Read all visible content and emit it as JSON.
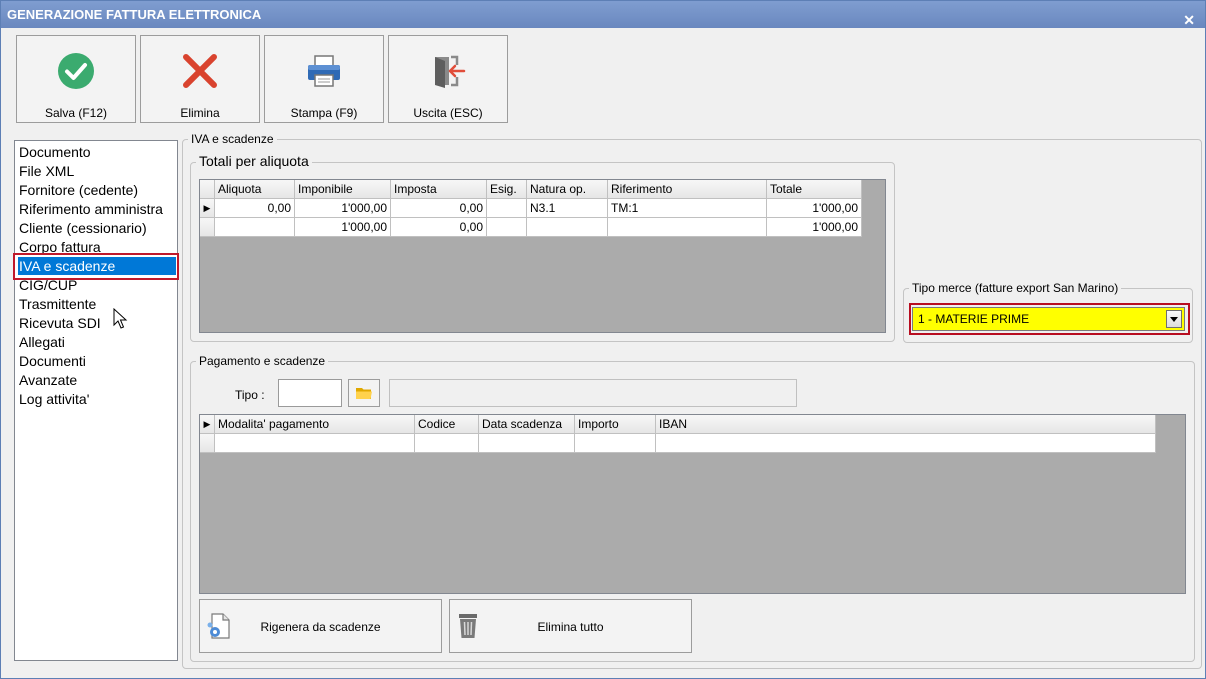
{
  "window": {
    "title": "GENERAZIONE FATTURA ELETTRONICA",
    "close_glyph": "✕"
  },
  "toolbar": [
    {
      "label": "Salva (F12)",
      "icon": "check-circle-icon",
      "color": "#3bab6f"
    },
    {
      "label": "Elimina",
      "icon": "x-mark-icon",
      "color": "#d9432e"
    },
    {
      "label": "Stampa (F9)",
      "icon": "printer-icon",
      "color": "#2f6ab5"
    },
    {
      "label": "Uscita (ESC)",
      "icon": "exit-door-icon",
      "color": "#e14d3a"
    }
  ],
  "nav": {
    "items": [
      "Documento",
      "File XML",
      "Fornitore (cedente)",
      "Riferimento amministra",
      "Cliente (cessionario)",
      "Corpo fattura",
      "IVA e scadenze",
      "CIG/CUP",
      "Trasmittente",
      "Ricevuta SDI",
      "Allegati",
      "Documenti",
      "Avanzate",
      "Log attivita'"
    ],
    "selected_index": 6
  },
  "iva_group": {
    "label": "IVA e scadenze",
    "totali": {
      "label": "Totali per aliquota",
      "columns": [
        "Aliquota",
        "Imponibile",
        "Imposta",
        "Esig.",
        "Natura op.",
        "Riferimento",
        "Totale"
      ],
      "rows": [
        [
          "0,00",
          "1'000,00",
          "0,00",
          "",
          "N3.1",
          "TM:1",
          "1'000,00"
        ],
        [
          "",
          "1'000,00",
          "0,00",
          "",
          "",
          "",
          "1'000,00"
        ]
      ]
    },
    "tipo_merce": {
      "label": "Tipo merce (fatture export San Marino)",
      "value": "1 - MATERIE PRIME",
      "highlight_color": "#ffff00"
    },
    "pagamento": {
      "label": "Pagamento e scadenze",
      "tipo_label": "Tipo :",
      "tipo_value": "",
      "tipo_description": "",
      "columns": [
        "Modalita' pagamento",
        "Codice",
        "Data scadenza",
        "Importo",
        "IBAN"
      ],
      "rows": [
        [
          "",
          "",
          "",
          "",
          ""
        ]
      ],
      "buttons": {
        "rigenera": "Rigenera da scadenze",
        "elimina_tutto": "Elimina tutto"
      }
    }
  }
}
